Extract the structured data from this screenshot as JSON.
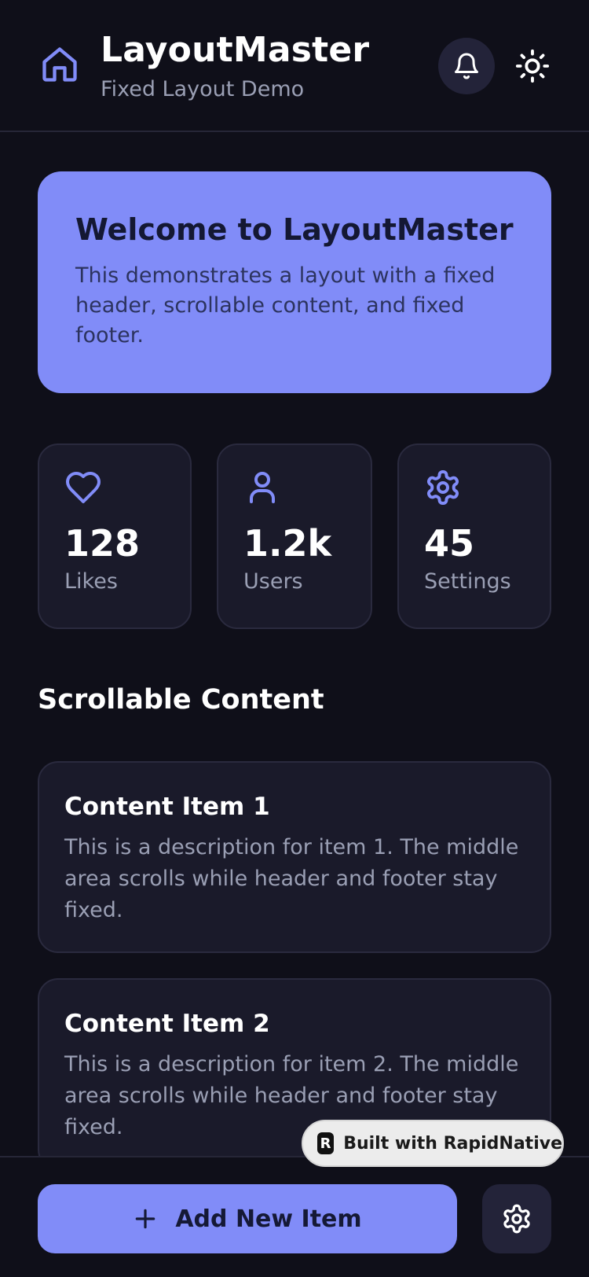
{
  "header": {
    "title": "LayoutMaster",
    "subtitle": "Fixed Layout Demo",
    "icons": {
      "home": "home-icon",
      "notifications": "bell-icon",
      "theme": "sun-icon"
    }
  },
  "welcome": {
    "title": "Welcome to LayoutMaster",
    "text": "This demonstrates a layout with a fixed header, scrollable content, and fixed footer."
  },
  "stats": [
    {
      "icon": "heart-icon",
      "value": "128",
      "label": "Likes"
    },
    {
      "icon": "user-icon",
      "value": "1.2k",
      "label": "Users"
    },
    {
      "icon": "gear-icon",
      "value": "45",
      "label": "Settings"
    }
  ],
  "section": {
    "title": "Scrollable Content"
  },
  "items": [
    {
      "title": "Content Item 1",
      "description": "This is a description for item 1. The middle area scrolls while header and footer stay fixed."
    },
    {
      "title": "Content Item 2",
      "description": "This is a description for item 2. The middle area scrolls while header and footer stay fixed."
    }
  ],
  "badge": {
    "logo": "R",
    "text": "Built with RapidNative"
  },
  "footer": {
    "add_label": "Add New Item",
    "settings_icon": "gear-icon"
  },
  "colors": {
    "background": "#0f0f19",
    "accent": "#818cf8",
    "card": "#1a1a2a",
    "muted_text": "#9a9fb4"
  }
}
